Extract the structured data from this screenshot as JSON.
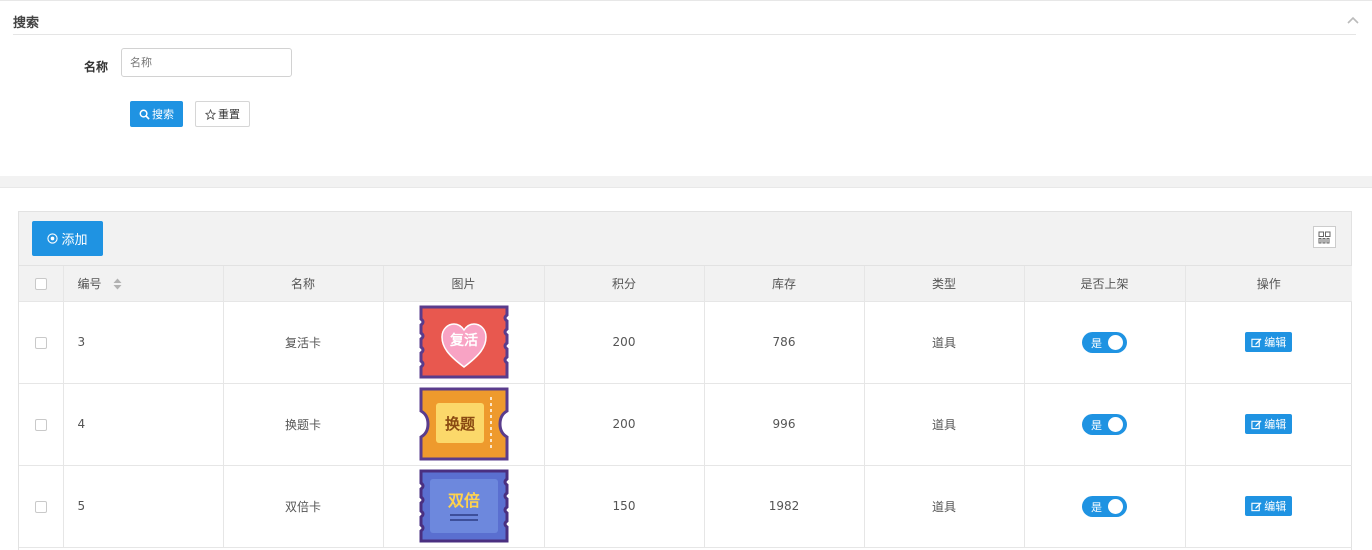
{
  "search": {
    "title": "搜索",
    "name_label": "名称",
    "name_placeholder": "名称",
    "search_button": "搜索",
    "reset_button": "重置"
  },
  "toolbar": {
    "add_button": "添加"
  },
  "table": {
    "headers": {
      "id": "编号",
      "name": "名称",
      "image": "图片",
      "points": "积分",
      "stock": "库存",
      "type": "类型",
      "on_shelf": "是否上架",
      "actions": "操作"
    },
    "rows": [
      {
        "id": "3",
        "name": "复活卡",
        "image_text": "复活",
        "points": "200",
        "stock": "786",
        "type": "道具",
        "on_shelf": "是",
        "edit": "编辑"
      },
      {
        "id": "4",
        "name": "换题卡",
        "image_text": "换题",
        "points": "200",
        "stock": "996",
        "type": "道具",
        "on_shelf": "是",
        "edit": "编辑"
      },
      {
        "id": "5",
        "name": "双倍卡",
        "image_text": "双倍",
        "points": "150",
        "stock": "1982",
        "type": "道具",
        "on_shelf": "是",
        "edit": "编辑"
      }
    ]
  },
  "colors": {
    "primary": "#1f93e2",
    "card_red": "#e8584f",
    "card_orange": "#ee9a2d",
    "card_blue": "#6a7fd9",
    "card_border": "#5a3c8c"
  },
  "icons": {
    "collapse": "chevron-up-icon",
    "search": "search-icon",
    "reset": "star-icon",
    "add": "add-circle-icon",
    "columns": "columns-icon",
    "sort": "sort-icon",
    "edit": "edit-icon"
  }
}
